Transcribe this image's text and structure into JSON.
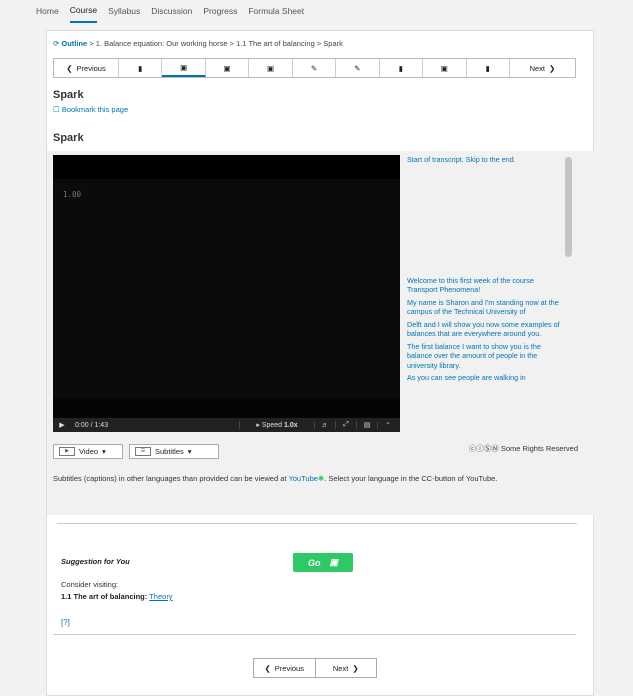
{
  "topnav": [
    "Home",
    "Course",
    "Syllabus",
    "Discussion",
    "Progress",
    "Formula Sheet"
  ],
  "breadcrumb": {
    "outline": "Outline",
    "trail": " > 1. Balance equation: Our working horse > 1.1 The art of balancing > Spark"
  },
  "sequence": {
    "previous": "Previous",
    "next": "Next",
    "tabs": [
      "book",
      "film",
      "film",
      "film",
      "edit",
      "edit",
      "book",
      "film",
      "book"
    ],
    "active_index": 1
  },
  "unit_title": "Spark",
  "bookmark": "Bookmark this page",
  "video_title": "Spark",
  "video": {
    "caption_overlay": "1.00",
    "time": "0:00 / 1:43",
    "speed_label": "Speed",
    "speed_value": "1.0x",
    "play_progress": 0.0
  },
  "transcript": [
    "Start of transcript. Skip to the end.",
    "Welcome to this first week of the course Transport Phenomena!",
    "My name is Sharon and I'm standing now at the campus of the Technical University of",
    "Delft and I will show you now some examples of balances that are everywhere around you.",
    "The first balance I want to show you is the balance over the amount of people in the university library.",
    "As you can see people are walking in"
  ],
  "rights": "Some Rights Reserved",
  "dropdowns": {
    "video": "Video",
    "subtitles": "Subtitles"
  },
  "subnote": {
    "before": "Subtitles (captions) in other languages than provided can be viewed at ",
    "link": "YouTube",
    "after": ". Select your language in the CC-button of YouTube."
  },
  "suggestion": {
    "title": "Suggestion for You",
    "go": "Go",
    "consider": "Consider visiting:",
    "item_bold": "1.1 The art of balancing:",
    "item_link": "Theory",
    "help": "[?]"
  },
  "bottom_nav": {
    "previous": "Previous",
    "next": "Next"
  },
  "colors": {
    "link": "#0075b4",
    "go_button": "#2ec866"
  }
}
